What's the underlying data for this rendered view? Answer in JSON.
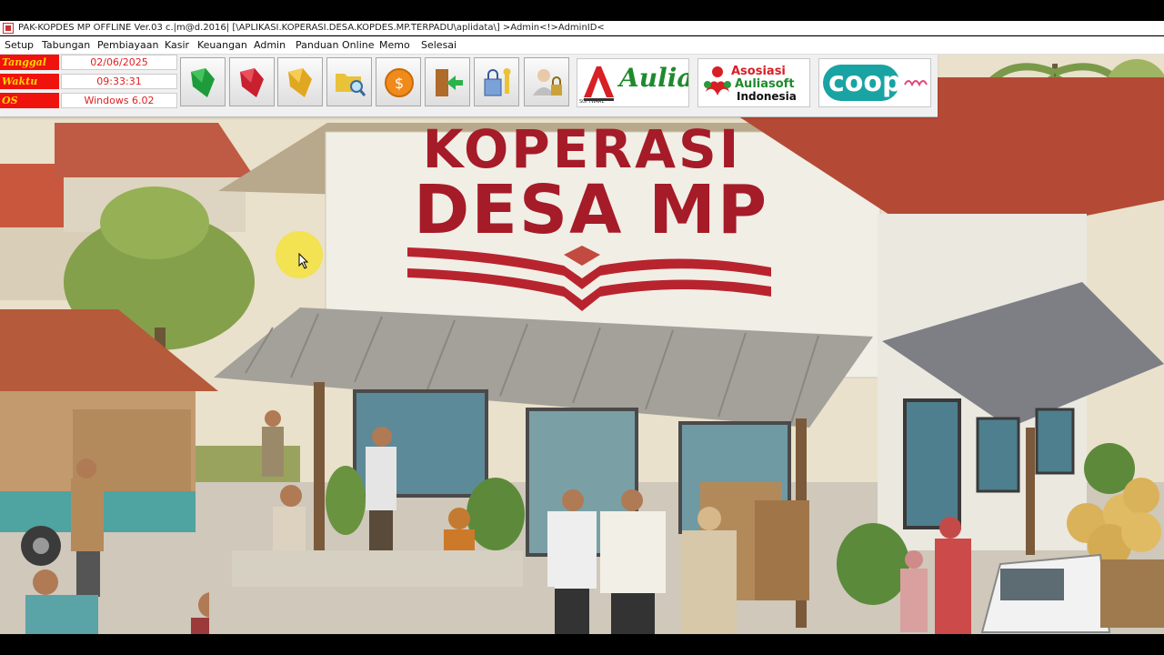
{
  "window": {
    "title": "PAK-KOPDES MP OFFLINE Ver.03 c.|m@d.2016| [\\APLIKASI.KOPERASI.DESA.KOPDES.MP.TERPADU\\aplidata\\] >Admin<!>AdminID<"
  },
  "menu": {
    "items": [
      "Setup",
      "Tabungan",
      "Pembiayaan",
      "Kasir",
      "Keuangan",
      "Admin",
      "Panduan Online",
      "Memo",
      "Selesai"
    ]
  },
  "info": {
    "date_label": "Tanggal",
    "date_value": "02/06/2025",
    "time_label": "Waktu",
    "time_value": "09:33:31",
    "os_label": "OS",
    "os_value": "Windows 6.02"
  },
  "toolbar": {
    "icons": [
      "green-gem-icon",
      "red-gem-icon",
      "yellow-gem-icon",
      "folder-search-icon",
      "coin-icon",
      "exit-door-icon",
      "lock-key-icon",
      "user-lock-icon"
    ]
  },
  "logos": {
    "software_brand": "SOFTWARE",
    "aulia": "Aulia",
    "asosiasi_line1": "Asosiasi",
    "asosiasi_line2": "Auliasoft",
    "asosiasi_line3": "Indonesia",
    "coop": "coop"
  },
  "banner": {
    "line1": "KOPERASI",
    "line2": "DESA MP"
  },
  "colors": {
    "label_red": "#f0120d",
    "label_yellow": "#ffd400",
    "value_red": "#e02020",
    "brand_red": "#a51b28",
    "coop_teal": "#1aa3a3",
    "aulia_green": "#1f8a2d"
  }
}
